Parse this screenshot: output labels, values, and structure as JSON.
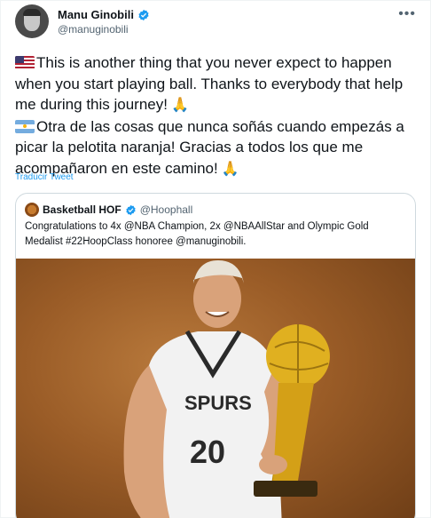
{
  "tweet": {
    "author_name": "Manu Ginobili",
    "author_handle": "@manuginobili",
    "text_en": "This is another thing that you never expect to happen when you start playing ball. Thanks to everybody that help me during this journey!",
    "text_es": "Otra de las cosas que nunca soñás cuando empezás a picar la pelotita naranja! Gracias a todos los que me acompañaron en este camino!",
    "translate_label": "Traducir Tweet",
    "more_icon": "•••"
  },
  "quoted": {
    "author_name": "Basketball HOF",
    "author_handle": "@Hoophall",
    "text": "Congratulations to 4x @NBA Champion, 2x @NBAAllStar and Olympic Gold Medalist #22HoopClass honoree @manuginobili."
  },
  "colors": {
    "link": "#1d9bf0",
    "verified": "#1d9bf0",
    "secondary_text": "#536471"
  },
  "icons": {
    "verified": "verified-badge-icon",
    "more": "more-icon",
    "flag_us": "us-flag-icon",
    "flag_ar": "argentina-flag-icon",
    "pray": "folded-hands-icon"
  }
}
